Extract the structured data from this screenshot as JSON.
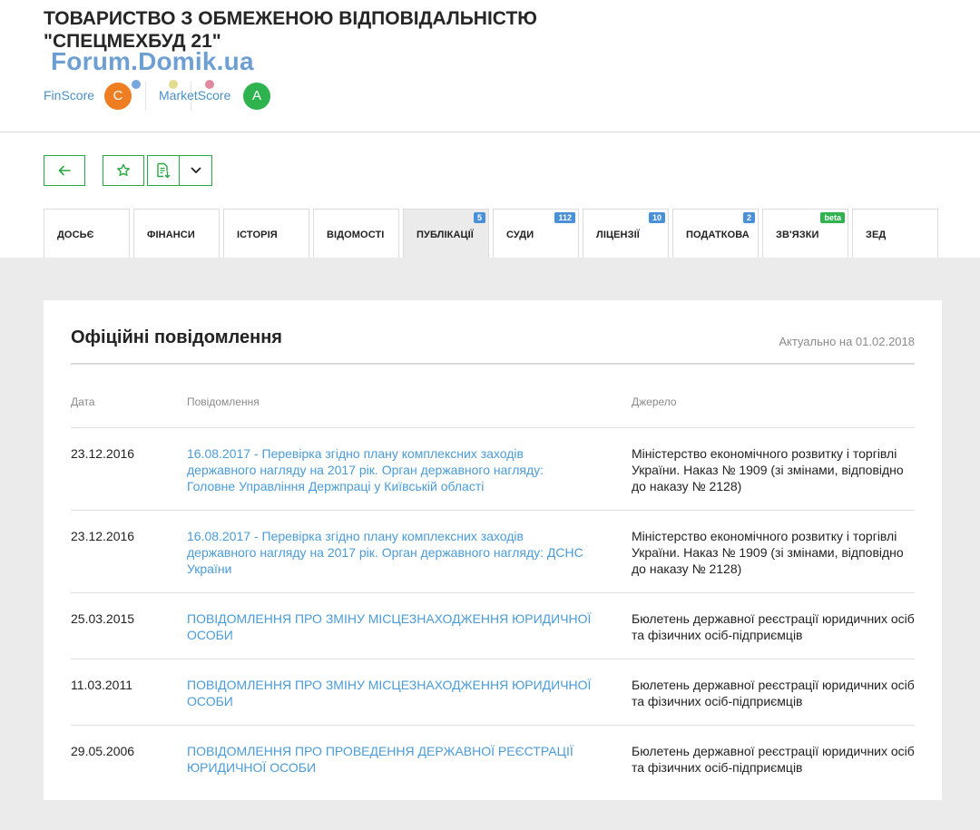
{
  "company": {
    "title_line1": "ТОВАРИСТВО З ОБМЕЖЕНОЮ ВІДПОВІДАЛЬНІСТЮ",
    "title_line2": "\"СПЕЦМЕХБУД 21\""
  },
  "watermark": "Forum.Domik.ua",
  "scores": {
    "finscore_label": "FinScore",
    "finscore_value": "C",
    "finscore_color": "#ef7d22",
    "marketscore_label": "MarketScore",
    "marketscore_value": "A",
    "marketscore_color": "#2fb34e"
  },
  "toolbar": {
    "back_icon": "arrow-left-icon",
    "favorite_icon": "star-icon",
    "export_icon": "document-download-icon",
    "more_icon": "chevron-down-icon",
    "accent_color": "#2aa745"
  },
  "tabs": [
    {
      "label": "ДОСЬЄ",
      "badge": ""
    },
    {
      "label": "ФІНАНСИ",
      "badge": ""
    },
    {
      "label": "ІСТОРІЯ",
      "badge": ""
    },
    {
      "label": "ВІДОМОСТІ",
      "badge": ""
    },
    {
      "label": "ПУБЛІКАЦІЇ",
      "badge": "5",
      "active": true
    },
    {
      "label": "СУДИ",
      "badge": "112"
    },
    {
      "label": "ЛІЦЕНЗІЇ",
      "badge": "10"
    },
    {
      "label": "ПОДАТКОВА",
      "badge": "2"
    },
    {
      "label": "ЗВ'ЯЗКИ",
      "badge": "beta"
    },
    {
      "label": "ЗЕД",
      "badge": ""
    }
  ],
  "card": {
    "title": "Офіційні повідомлення",
    "updated": "Актуально на 01.02.2018",
    "columns": {
      "date": "Дата",
      "message": "Повідомлення",
      "source": "Джерело"
    },
    "rows": [
      {
        "date": "23.12.2016",
        "message": "16.08.2017 - Перевірка згідно плану комплексних заходів державного нагляду на 2017 рік. Орган державного нагляду: Головне Управління Держпраці у Київській області",
        "source": "Міністерство економічного розвитку і торгівлі України. Наказ № 1909 (зі змінами, відповідно до наказу № 2128)"
      },
      {
        "date": "23.12.2016",
        "message": "16.08.2017 - Перевірка згідно плану комплексних заходів державного нагляду на 2017 рік. Орган державного нагляду: ДСНС України",
        "source": "Міністерство економічного розвитку і торгівлі України. Наказ № 1909 (зі змінами, відповідно до наказу № 2128)"
      },
      {
        "date": "25.03.2015",
        "message": "ПОВІДОМЛЕННЯ ПРО ЗМІНУ МІСЦЕЗНАХОДЖЕННЯ ЮРИДИЧНОЇ ОСОБИ",
        "source": "Бюлетень державної реєстрації юридичних осіб та фізичних осіб-підприємців"
      },
      {
        "date": "11.03.2011",
        "message": "ПОВІДОМЛЕННЯ ПРО ЗМІНУ МІСЦЕЗНАХОДЖЕННЯ ЮРИДИЧНОЇ ОСОБИ",
        "source": "Бюлетень державної реєстрації юридичних осіб та фізичних осіб-підприємців"
      },
      {
        "date": "29.05.2006",
        "message": "ПОВІДОМЛЕННЯ ПРО ПРОВЕДЕННЯ ДЕРЖАВНОЇ РЕЄСТРАЦІЇ ЮРИДИЧНОЇ ОСОБИ",
        "source": "Бюлетень державної реєстрації юридичних осіб та фізичних осіб-підприємців"
      }
    ]
  }
}
